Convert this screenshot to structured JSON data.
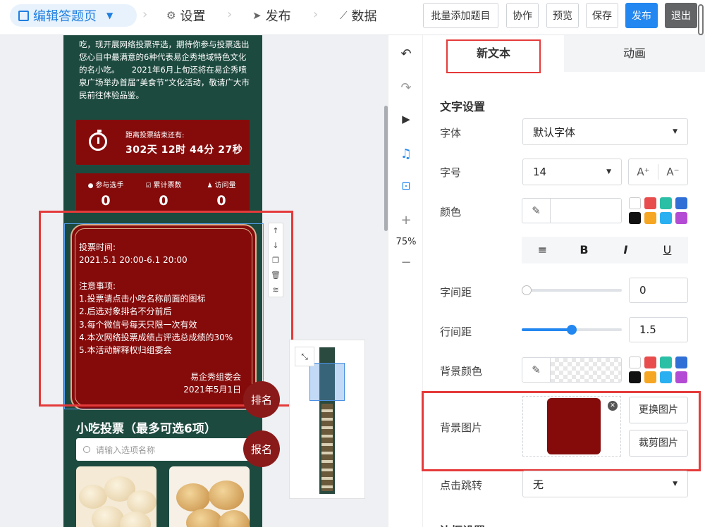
{
  "topbar": {
    "nav_edit": "编辑答题页",
    "nav_settings": "设置",
    "nav_publish": "发布",
    "nav_data": "数据",
    "btn_batch_add": "批量添加题目",
    "btn_collab": "协作",
    "btn_preview": "预览",
    "btn_save": "保存",
    "btn_publish": "发布",
    "btn_exit": "退出"
  },
  "phone": {
    "intro": "吃，现开展网络投票评选，期待你参与投票选出您心目中最满意的6种代表易企秀地域特色文化的名小吃。　　2021年6月上旬还将在易企秀喷泉广场举办首届”美食节“文化活动，敬请广大市民前往体验品鉴。",
    "countdown_label": "距离投票结束还有:",
    "countdown_value": "302天 12时 44分 27秒",
    "stats": [
      {
        "label": "参与选手",
        "value": "0"
      },
      {
        "label": "累计票数",
        "value": "0"
      },
      {
        "label": "访问量",
        "value": "0"
      }
    ],
    "notice": "投票时间:\n2021.5.1 20:00-6.1 20:00\n\n注意事项:\n1.投票请点击小吃名称前面的图标\n2.后选对象排名不分前后\n3.每个微信号每天只限一次有效\n4.本次网络投票成绩占评选总成绩的30%\n5.本活动解释权归组委会",
    "notice_sign_org": "易企秀组委会",
    "notice_sign_date": "2021年5月1日",
    "snack_title": "小吃投票（最多可选6项）",
    "search_placeholder": "请输入选项名称",
    "btn_rank": "排名",
    "btn_signup": "报名"
  },
  "zoom": "75%",
  "panel": {
    "tab_text": "新文本",
    "tab_anim": "动画",
    "section_text": "文字设置",
    "font_label": "字体",
    "font_value": "默认字体",
    "size_label": "字号",
    "size_value": "14",
    "size_up": "A⁺",
    "size_down": "A⁻",
    "color_label": "颜色",
    "format_buttons": [
      "≡",
      "B",
      "I",
      "U"
    ],
    "spacing_label": "字间距",
    "spacing_value": "0",
    "spacing_level": 0,
    "lineheight_label": "行间距",
    "lineheight_value": "1.5",
    "lineheight_level": 0.5,
    "bgcolor_label": "背景颜色",
    "bgimage_label": "背景图片",
    "btn_replace_image": "更换图片",
    "btn_crop_image": "裁剪图片",
    "jump_label": "点击跳转",
    "jump_value": "无",
    "bottom_cutoff": "边框设置"
  },
  "colors": {
    "accent": "#2287f0",
    "phone_bg": "#1d4a3f",
    "block_red": "#850b0b",
    "highlight_red": "#e53a3a",
    "swatches": [
      "#ffffff",
      "#e84c4c",
      "#2bbfa6",
      "#2f6fd6",
      "#111111",
      "#f5a623",
      "#2ab0f0",
      "#b44bd4"
    ]
  }
}
